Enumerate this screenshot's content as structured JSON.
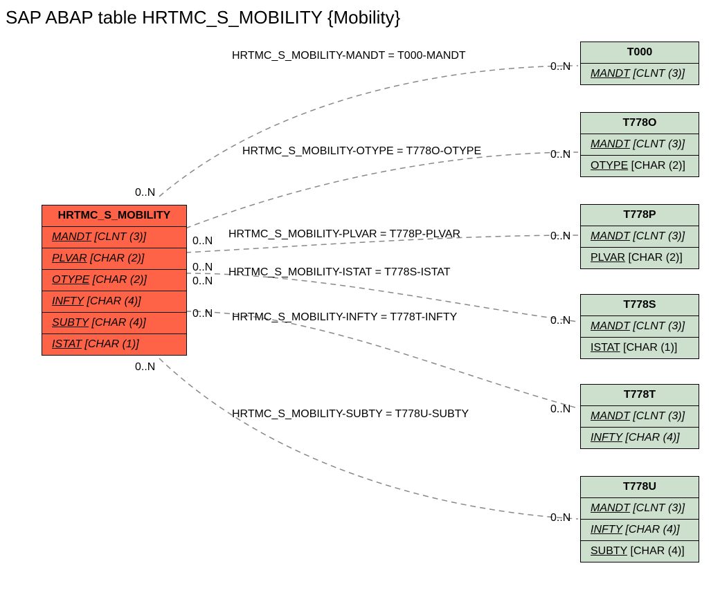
{
  "title": "SAP ABAP table HRTMC_S_MOBILITY {Mobility}",
  "main": {
    "name": "HRTMC_S_MOBILITY",
    "fields": {
      "mandt": "MANDT [CLNT (3)]",
      "plvar": "PLVAR [CHAR (2)]",
      "otype": "OTYPE [CHAR (2)]",
      "infty": "INFTY [CHAR (4)]",
      "subty": "SUBTY [CHAR (4)]",
      "istat": "ISTAT [CHAR (1)]"
    }
  },
  "refs": {
    "T000": {
      "name": "T000",
      "f1": "MANDT [CLNT (3)]"
    },
    "T778O": {
      "name": "T778O",
      "f1": "MANDT [CLNT (3)]",
      "f2": "OTYPE [CHAR (2)]"
    },
    "T778P": {
      "name": "T778P",
      "f1": "MANDT [CLNT (3)]",
      "f2": "PLVAR [CHAR (2)]"
    },
    "T778S": {
      "name": "T778S",
      "f1": "MANDT [CLNT (3)]",
      "f2": "ISTAT [CHAR (1)]"
    },
    "T778T": {
      "name": "T778T",
      "f1": "MANDT [CLNT (3)]",
      "f2": "INFTY [CHAR (4)]"
    },
    "T778U": {
      "name": "T778U",
      "f1": "MANDT [CLNT (3)]",
      "f2": "INFTY [CHAR (4)]",
      "f3": "SUBTY [CHAR (4)]"
    }
  },
  "edges": {
    "e1": "HRTMC_S_MOBILITY-MANDT = T000-MANDT",
    "e2": "HRTMC_S_MOBILITY-OTYPE = T778O-OTYPE",
    "e3": "HRTMC_S_MOBILITY-PLVAR = T778P-PLVAR",
    "e4": "HRTMC_S_MOBILITY-ISTAT = T778S-ISTAT",
    "e5": "HRTMC_S_MOBILITY-INFTY = T778T-INFTY",
    "e6": "HRTMC_S_MOBILITY-SUBTY = T778U-SUBTY"
  },
  "card": "0..N"
}
